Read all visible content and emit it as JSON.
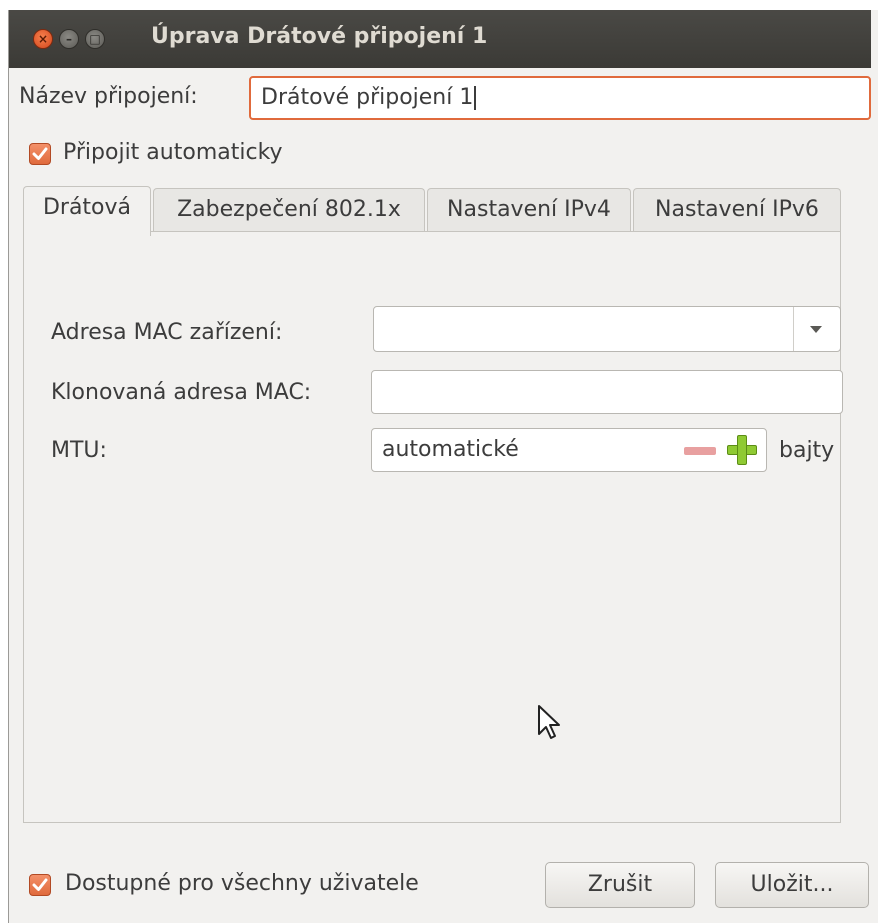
{
  "window": {
    "title": "Úprava Drátové připojení 1",
    "controls": {
      "close": "×",
      "minimize": "–",
      "maximize": "□"
    }
  },
  "connection_name": {
    "label": "Název připojení:",
    "value": "Drátové připojení 1"
  },
  "auto_connect": {
    "label": "Připojit automaticky",
    "checked": true
  },
  "tabs": [
    {
      "label": "Drátová",
      "active": true
    },
    {
      "label": "Zabezpečení 802.1x",
      "active": false
    },
    {
      "label": "Nastavení IPv4",
      "active": false
    },
    {
      "label": "Nastavení IPv6",
      "active": false
    }
  ],
  "wired": {
    "mac_label": "Adresa MAC zařízení:",
    "mac_value": "",
    "cloned_mac_label": "Klonovaná adresa MAC:",
    "cloned_mac_value": "",
    "mtu_label": "MTU:",
    "mtu_value": "automatické",
    "mtu_unit": "bajty"
  },
  "all_users": {
    "label": "Dostupné pro všechny uživatele",
    "checked": true
  },
  "buttons": {
    "cancel": "Zrušit",
    "save": "Uložit..."
  },
  "colors": {
    "accent": "#e06a3c",
    "titlebar": "#3c3b37",
    "window_bg": "#f2f1ef"
  },
  "icons": [
    "close-icon",
    "minimize-icon",
    "maximize-icon",
    "check-icon",
    "dropdown-arrow-icon",
    "minus-icon",
    "plus-icon",
    "mouse-pointer-icon"
  ]
}
